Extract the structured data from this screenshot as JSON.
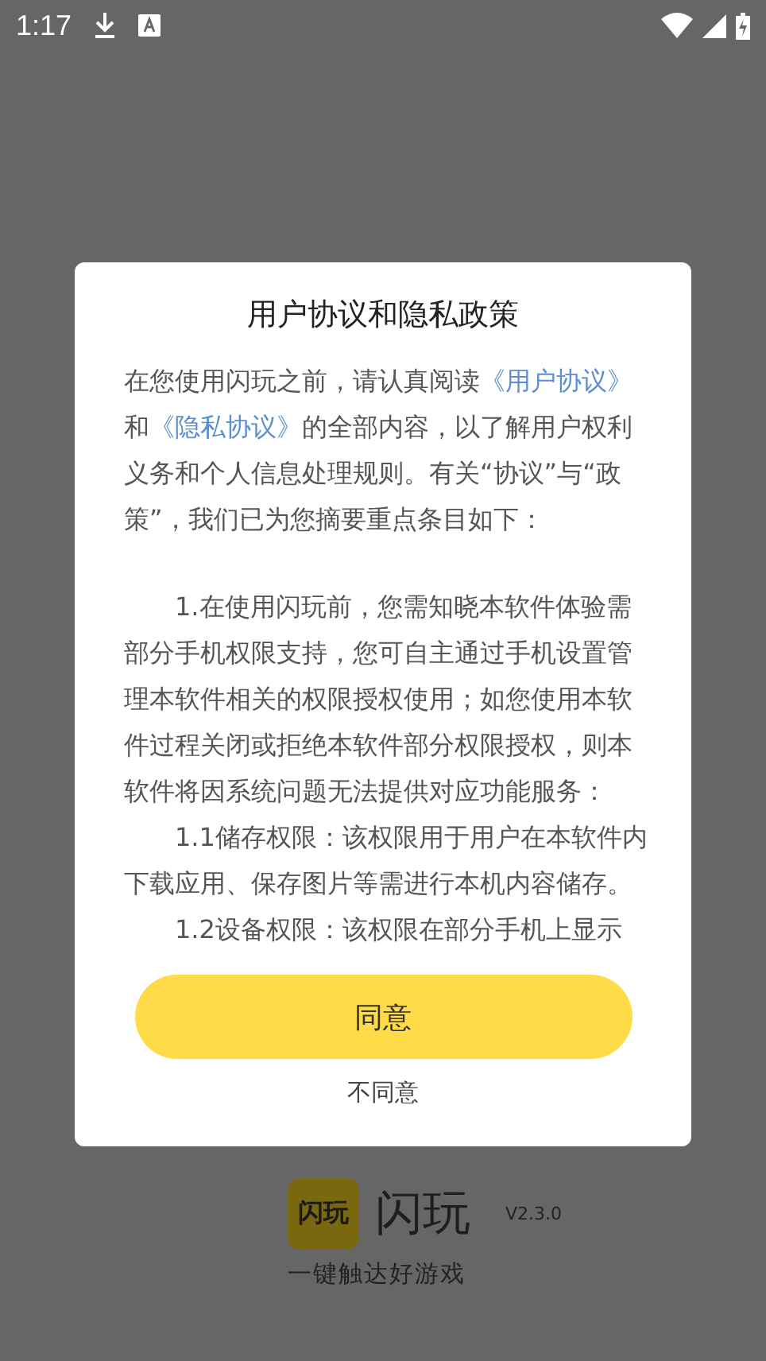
{
  "status_bar": {
    "time": "1:17"
  },
  "dialog": {
    "title": "用户协议和隐私政策",
    "intro": [
      {
        "kind": "text",
        "text": "在您使用闪玩之前，请认真阅读"
      },
      {
        "kind": "link",
        "text": "《用户协议》"
      },
      {
        "kind": "text",
        "text": "和"
      },
      {
        "kind": "link",
        "text": "《隐私协议》"
      },
      {
        "kind": "text",
        "text": "的全部内容，以了解用户权利义务和个人信息处理规则。有关“协议”与“政策”，我们已为您摘要重点条目如下："
      }
    ],
    "paragraphs": [
      "1.在使用闪玩前，您需知晓本软件体验需部分手机权限支持，您可自主通过手机设置管理本软件相关的权限授权使用；如您使用本软件过程关闭或拒绝本软件部分权限授权，则本软件将因系统问题无法提供对应功能服务：",
      "1.1储存权限：该权限用于用户在本软件内下载应用、保存图片等需进行本机内容储存。",
      "1.2设备权限：该权限在部分手机上显示"
    ],
    "agree_button": "同意",
    "decline_button": "不同意"
  },
  "branding": {
    "logo_text": "闪玩",
    "app_name": "闪玩",
    "version": "V2.3.0",
    "tagline": "一键触达好游戏"
  }
}
